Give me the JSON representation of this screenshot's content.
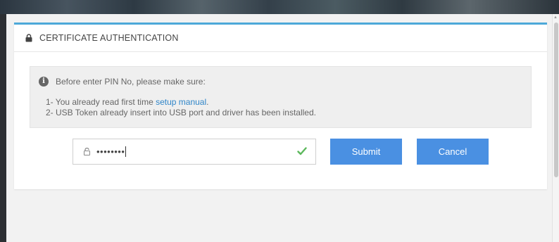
{
  "panel": {
    "title": "CERTIFICATE AUTHENTICATION",
    "accent_color": "#4da9d9"
  },
  "info": {
    "intro": "Before enter PIN No, please make sure:",
    "item1_prefix": "1- You already read first time ",
    "item1_link": "setup manual",
    "item1_suffix": ".",
    "item2": "2- USB Token already insert into USB port and driver has been installed."
  },
  "pin": {
    "masked_value": "••••••••",
    "valid": true
  },
  "buttons": {
    "submit_label": "Submit",
    "cancel_label": "Cancel",
    "color": "#4a90e2"
  },
  "icons": {
    "header": "lock-icon",
    "info": "info-icon",
    "field": "lock-icon",
    "status": "check-icon"
  }
}
